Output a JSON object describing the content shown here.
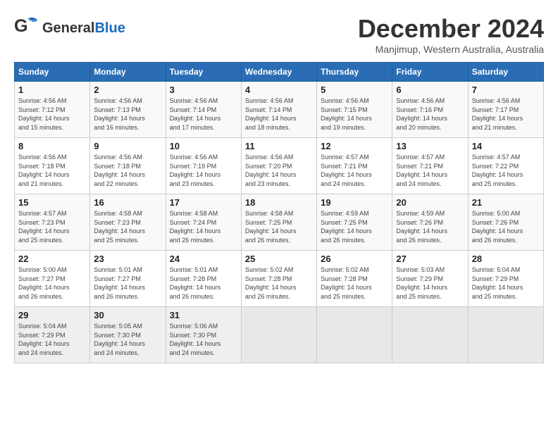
{
  "header": {
    "logo_general": "General",
    "logo_blue": "Blue",
    "month": "December 2024",
    "location": "Manjimup, Western Australia, Australia"
  },
  "weekdays": [
    "Sunday",
    "Monday",
    "Tuesday",
    "Wednesday",
    "Thursday",
    "Friday",
    "Saturday"
  ],
  "weeks": [
    [
      {
        "day": "1",
        "info": "Sunrise: 4:56 AM\nSunset: 7:12 PM\nDaylight: 14 hours\nand 15 minutes."
      },
      {
        "day": "2",
        "info": "Sunrise: 4:56 AM\nSunset: 7:13 PM\nDaylight: 14 hours\nand 16 minutes."
      },
      {
        "day": "3",
        "info": "Sunrise: 4:56 AM\nSunset: 7:14 PM\nDaylight: 14 hours\nand 17 minutes."
      },
      {
        "day": "4",
        "info": "Sunrise: 4:56 AM\nSunset: 7:14 PM\nDaylight: 14 hours\nand 18 minutes."
      },
      {
        "day": "5",
        "info": "Sunrise: 4:56 AM\nSunset: 7:15 PM\nDaylight: 14 hours\nand 19 minutes."
      },
      {
        "day": "6",
        "info": "Sunrise: 4:56 AM\nSunset: 7:16 PM\nDaylight: 14 hours\nand 20 minutes."
      },
      {
        "day": "7",
        "info": "Sunrise: 4:56 AM\nSunset: 7:17 PM\nDaylight: 14 hours\nand 21 minutes."
      }
    ],
    [
      {
        "day": "8",
        "info": "Sunrise: 4:56 AM\nSunset: 7:18 PM\nDaylight: 14 hours\nand 21 minutes."
      },
      {
        "day": "9",
        "info": "Sunrise: 4:56 AM\nSunset: 7:18 PM\nDaylight: 14 hours\nand 22 minutes."
      },
      {
        "day": "10",
        "info": "Sunrise: 4:56 AM\nSunset: 7:19 PM\nDaylight: 14 hours\nand 23 minutes."
      },
      {
        "day": "11",
        "info": "Sunrise: 4:56 AM\nSunset: 7:20 PM\nDaylight: 14 hours\nand 23 minutes."
      },
      {
        "day": "12",
        "info": "Sunrise: 4:57 AM\nSunset: 7:21 PM\nDaylight: 14 hours\nand 24 minutes."
      },
      {
        "day": "13",
        "info": "Sunrise: 4:57 AM\nSunset: 7:21 PM\nDaylight: 14 hours\nand 24 minutes."
      },
      {
        "day": "14",
        "info": "Sunrise: 4:57 AM\nSunset: 7:22 PM\nDaylight: 14 hours\nand 25 minutes."
      }
    ],
    [
      {
        "day": "15",
        "info": "Sunrise: 4:57 AM\nSunset: 7:23 PM\nDaylight: 14 hours\nand 25 minutes."
      },
      {
        "day": "16",
        "info": "Sunrise: 4:58 AM\nSunset: 7:23 PM\nDaylight: 14 hours\nand 25 minutes."
      },
      {
        "day": "17",
        "info": "Sunrise: 4:58 AM\nSunset: 7:24 PM\nDaylight: 14 hours\nand 26 minutes."
      },
      {
        "day": "18",
        "info": "Sunrise: 4:58 AM\nSunset: 7:25 PM\nDaylight: 14 hours\nand 26 minutes."
      },
      {
        "day": "19",
        "info": "Sunrise: 4:59 AM\nSunset: 7:25 PM\nDaylight: 14 hours\nand 26 minutes."
      },
      {
        "day": "20",
        "info": "Sunrise: 4:59 AM\nSunset: 7:26 PM\nDaylight: 14 hours\nand 26 minutes."
      },
      {
        "day": "21",
        "info": "Sunrise: 5:00 AM\nSunset: 7:26 PM\nDaylight: 14 hours\nand 26 minutes."
      }
    ],
    [
      {
        "day": "22",
        "info": "Sunrise: 5:00 AM\nSunset: 7:27 PM\nDaylight: 14 hours\nand 26 minutes."
      },
      {
        "day": "23",
        "info": "Sunrise: 5:01 AM\nSunset: 7:27 PM\nDaylight: 14 hours\nand 26 minutes."
      },
      {
        "day": "24",
        "info": "Sunrise: 5:01 AM\nSunset: 7:28 PM\nDaylight: 14 hours\nand 26 minutes."
      },
      {
        "day": "25",
        "info": "Sunrise: 5:02 AM\nSunset: 7:28 PM\nDaylight: 14 hours\nand 26 minutes."
      },
      {
        "day": "26",
        "info": "Sunrise: 5:02 AM\nSunset: 7:28 PM\nDaylight: 14 hours\nand 25 minutes."
      },
      {
        "day": "27",
        "info": "Sunrise: 5:03 AM\nSunset: 7:29 PM\nDaylight: 14 hours\nand 25 minutes."
      },
      {
        "day": "28",
        "info": "Sunrise: 5:04 AM\nSunset: 7:29 PM\nDaylight: 14 hours\nand 25 minutes."
      }
    ],
    [
      {
        "day": "29",
        "info": "Sunrise: 5:04 AM\nSunset: 7:29 PM\nDaylight: 14 hours\nand 24 minutes."
      },
      {
        "day": "30",
        "info": "Sunrise: 5:05 AM\nSunset: 7:30 PM\nDaylight: 14 hours\nand 24 minutes."
      },
      {
        "day": "31",
        "info": "Sunrise: 5:06 AM\nSunset: 7:30 PM\nDaylight: 14 hours\nand 24 minutes."
      },
      {
        "day": "",
        "info": ""
      },
      {
        "day": "",
        "info": ""
      },
      {
        "day": "",
        "info": ""
      },
      {
        "day": "",
        "info": ""
      }
    ]
  ]
}
